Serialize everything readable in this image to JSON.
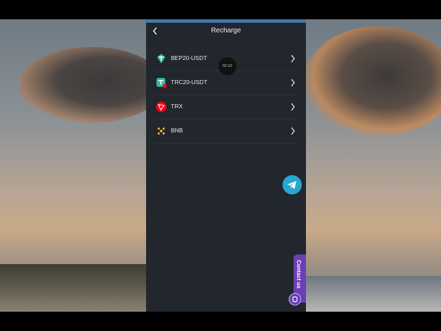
{
  "header": {
    "back_icon": "chevron-left-icon",
    "title": "Recharge"
  },
  "timer": {
    "time": "02:12"
  },
  "coins": [
    {
      "label": "BEP20-USDT",
      "icon": "tether-bep20-icon",
      "color": "#2fb89b"
    },
    {
      "label": "TRC20-USDT",
      "icon": "tether-trc20-icon",
      "color": "#2fb89b"
    },
    {
      "label": "TRX",
      "icon": "tron-icon",
      "color": "#ff0013"
    },
    {
      "label": "BNB",
      "icon": "bnb-icon",
      "color": "#f3ba2f"
    }
  ],
  "floating": {
    "telegram_icon": "telegram-icon",
    "contact_label": "Contact us",
    "contact_icon": "chat-icon"
  },
  "colors": {
    "topbar": "#3d7bb0",
    "panel": "#22262d",
    "telegram": "#29a7cf",
    "contact": "#6a3fb5"
  }
}
